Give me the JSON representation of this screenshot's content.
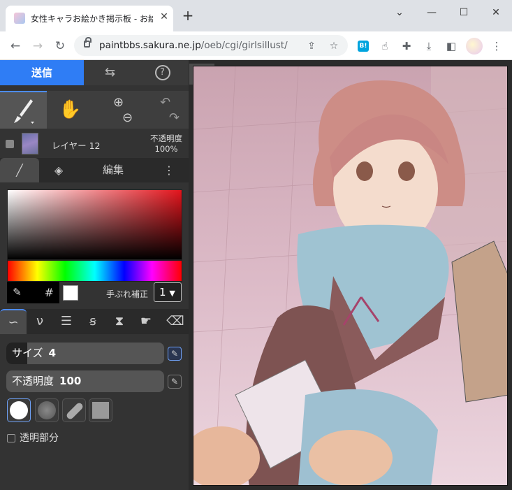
{
  "tab": {
    "title": "女性キャラお絵かき掲示板 - お絵かき"
  },
  "address": {
    "url_host": "paintbbs.sakura.ne.jp",
    "url_path": "/oeb/cgi/girlsillust/"
  },
  "extensions": {
    "hatena_label": "B!"
  },
  "app": {
    "send_label": "送信",
    "layer": {
      "name": "レイヤー 12",
      "opacity_label": "不透明度",
      "opacity_value": "100%"
    },
    "panel_tabs": {
      "edit_label": "編集"
    },
    "color": {
      "hash_label": "#",
      "stabilizer_label": "手ぶれ補正",
      "stabilizer_value": "1",
      "current_color": "#ffffff"
    },
    "size": {
      "label": "サイズ",
      "value": "4"
    },
    "opacity": {
      "label": "不透明度",
      "value": "100"
    },
    "transparent_label": "透明部分"
  }
}
